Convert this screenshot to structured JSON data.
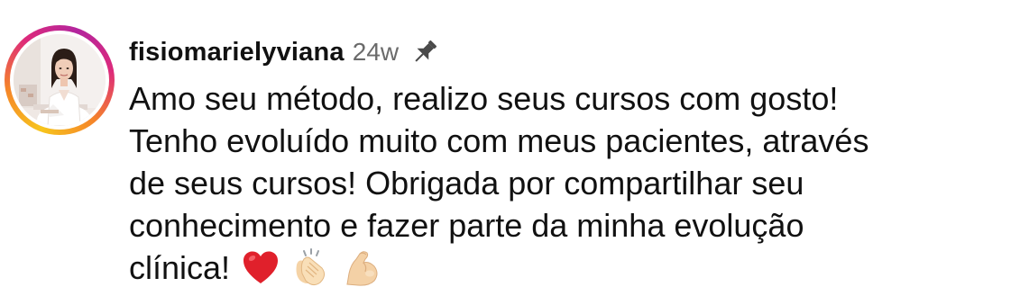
{
  "comment": {
    "username": "fisiomarielyviana",
    "time_ago": "24w",
    "pinned": true,
    "text_lines": [
      "Amo seu método, realizo seus cursos com gosto!",
      "Tenho evoluído muito com meus pacientes, através",
      "de seus cursos! Obrigada por compartilhar seu",
      "conhecimento e fazer parte da minha evolução",
      "clínica!"
    ],
    "emojis": [
      "red-heart",
      "clapping-hands",
      "flexed-biceps"
    ],
    "icons": {
      "pin": "pin-icon",
      "avatar_ring": "story-ring"
    },
    "colors": {
      "username": "#111111",
      "time": "#6b6b6b",
      "ring_start": "#f7c51d",
      "ring_mid": "#dd2a7b",
      "ring_end": "#b3259e",
      "heart": "#e0202b"
    }
  }
}
